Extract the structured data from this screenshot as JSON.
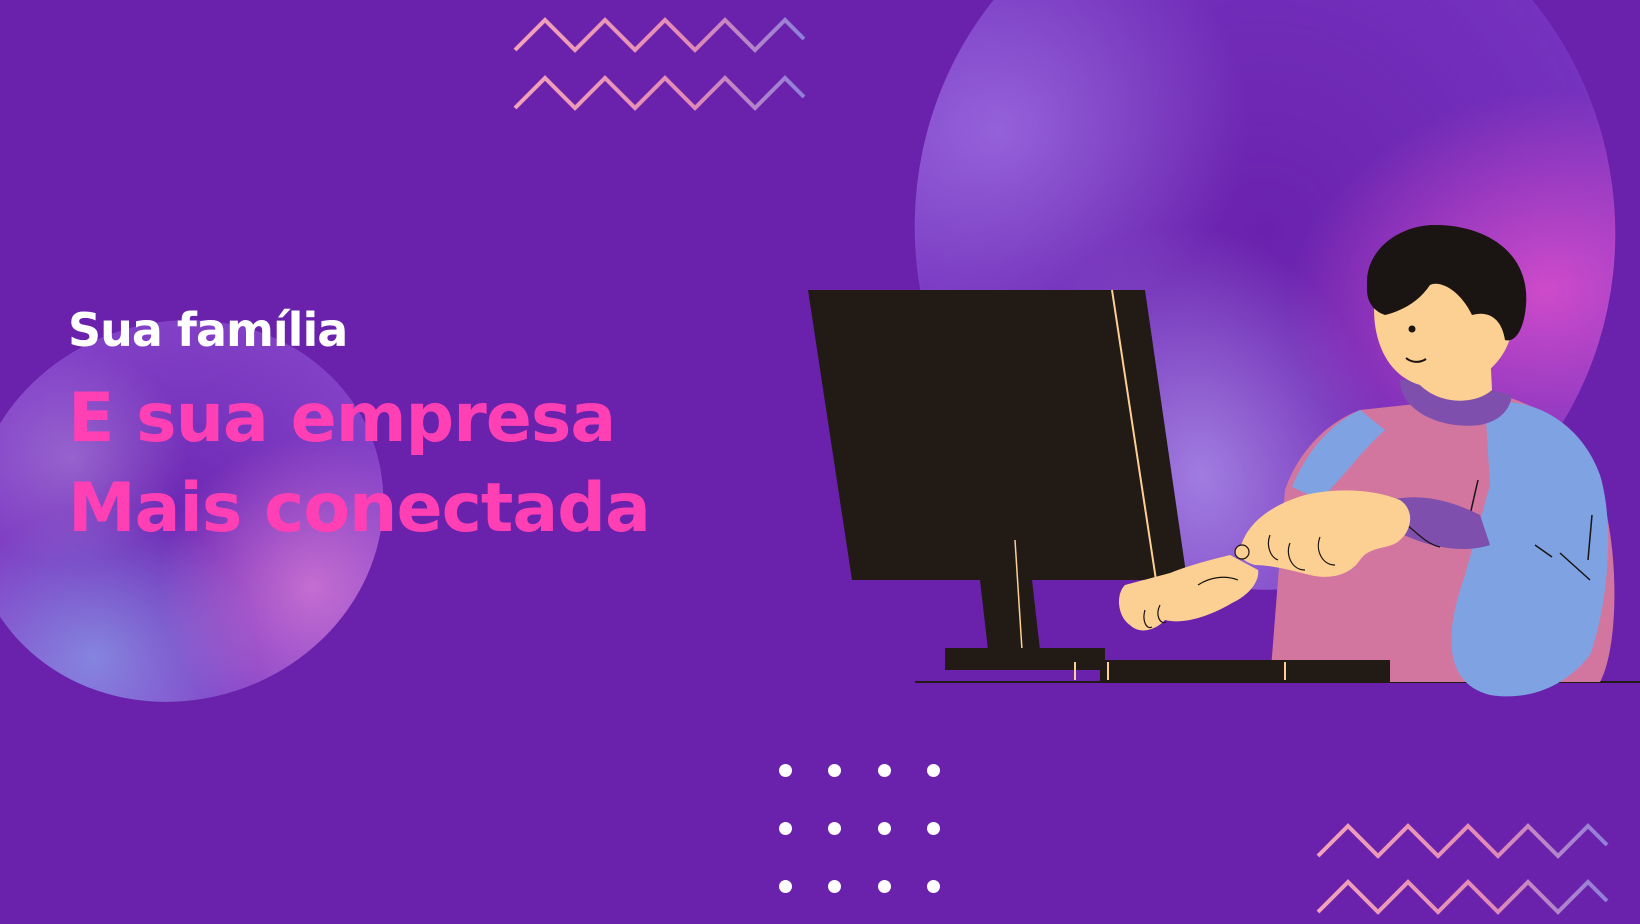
{
  "slide": {
    "eyebrow": "Sua família",
    "title_lines": [
      "E sua empresa",
      "Mais conectada"
    ]
  },
  "colors": {
    "background": "#6a22ad",
    "eyebrow_text": "#ffffff",
    "title_text": "#ff3fb4",
    "zigzag_start": "#f4a3b8",
    "zigzag_end": "#8f7fd9",
    "monitor": "#221a15",
    "skin": "#fccf92",
    "shirt_sleeve": "#7ea2e2",
    "shirt_body": "#d2769f",
    "collar": "#7f4fae",
    "hair": "#1a1412"
  },
  "illustration": {
    "subject": "person-using-computer",
    "icons": [
      "monitor-icon",
      "keyboard-icon",
      "person-icon"
    ]
  },
  "decorations": [
    "zigzag-top",
    "zigzag-bottom-right",
    "dot-grid",
    "bubble-left",
    "bubble-right"
  ]
}
